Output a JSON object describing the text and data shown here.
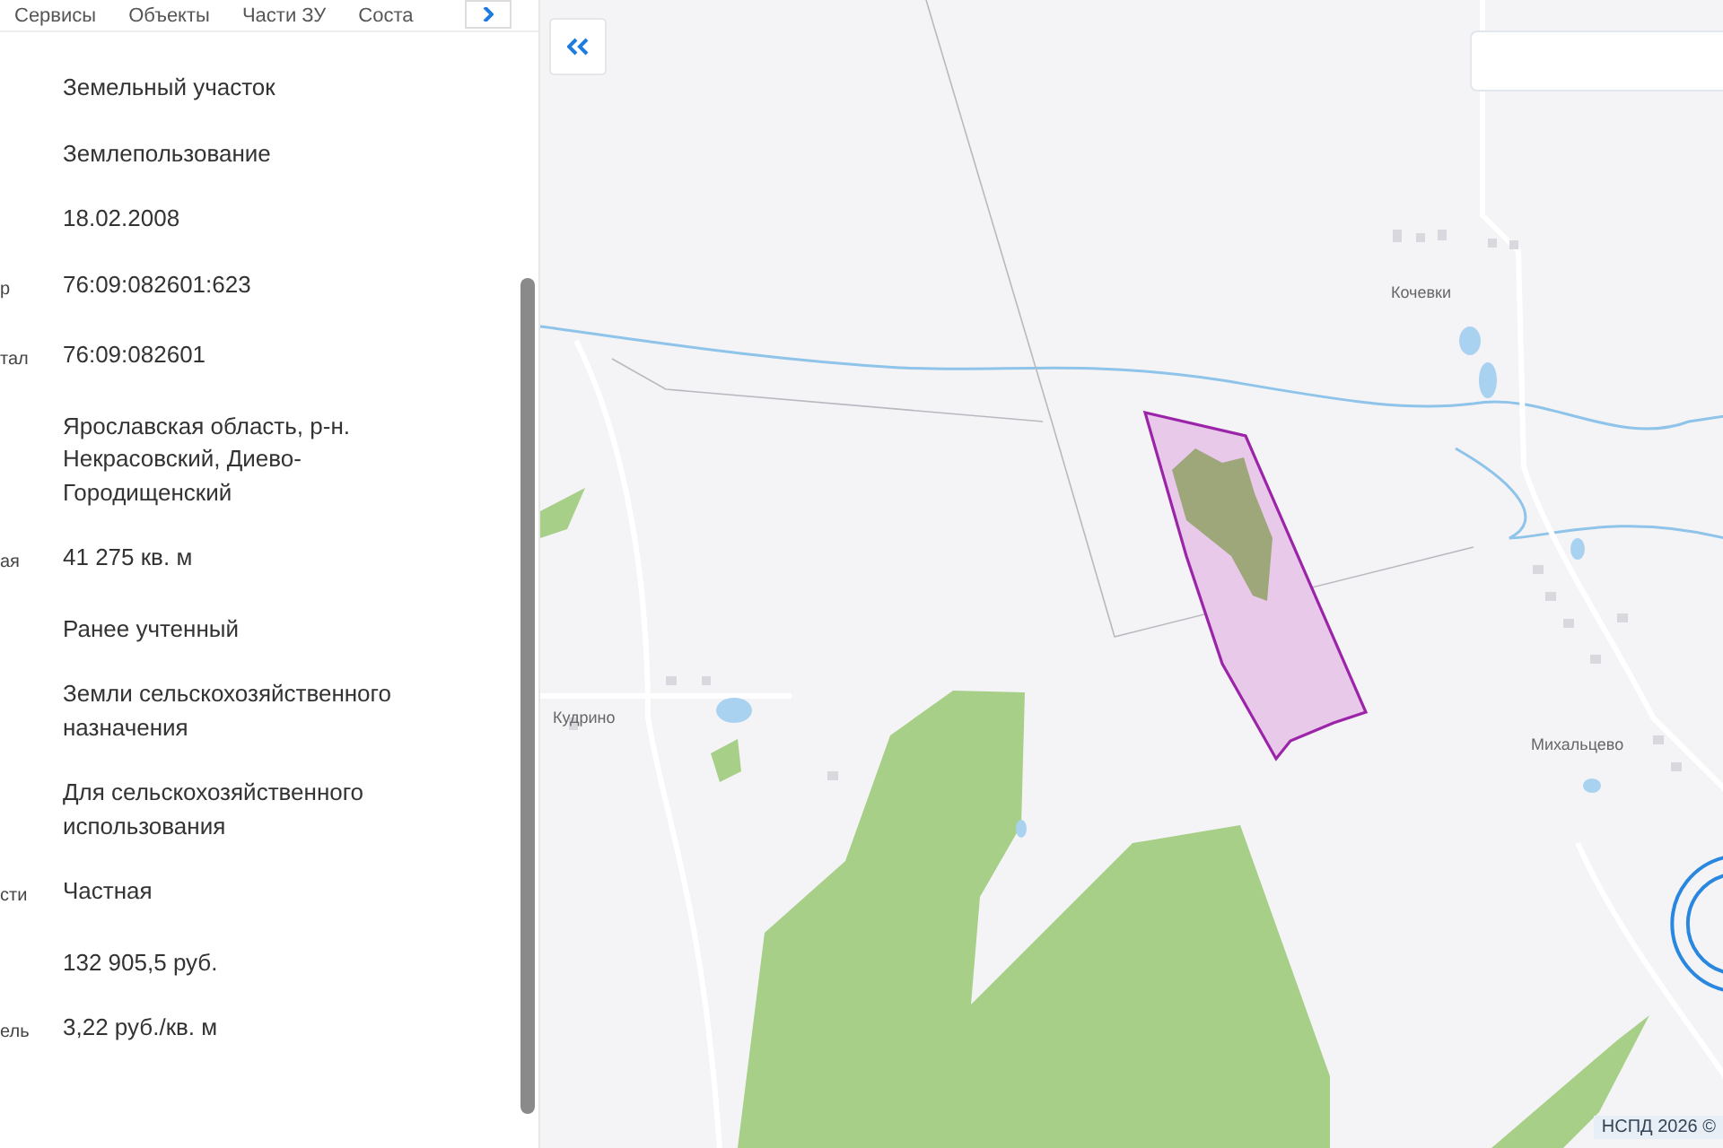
{
  "tabs": [
    {
      "label": "Сервисы",
      "selected": false
    },
    {
      "label": "Объекты",
      "selected": false
    },
    {
      "label": "Части ЗУ",
      "selected": false
    },
    {
      "label": "Соста",
      "selected": false
    }
  ],
  "properties": [
    {
      "value": "Земельный участок"
    },
    {
      "value": "Землепользование"
    },
    {
      "value": "18.02.2008"
    },
    {
      "label": "р",
      "value": "76:09:082601:623"
    },
    {
      "label": "тал",
      "value": "76:09:082601"
    },
    {
      "value": "Ярославская область, р-н. Некрасовский, Диево-Городищенский"
    },
    {
      "label": "ая",
      "value": "41 275 кв. м"
    },
    {
      "value": "Ранее учтенный"
    },
    {
      "value": "Земли сельскохозяйственного назначения"
    },
    {
      "value": "Для сельскохозяйственного использования"
    },
    {
      "label": "сти",
      "value": "Частная"
    },
    {
      "value": "132 905,5 руб."
    },
    {
      "label": "ель",
      "value": "3,22 руб./кв. м"
    }
  ],
  "map": {
    "places": [
      {
        "name": "Кочевки"
      },
      {
        "name": "Кудрино"
      },
      {
        "name": "Михальцево"
      }
    ],
    "attribution": "НСПД 2026 ©"
  }
}
